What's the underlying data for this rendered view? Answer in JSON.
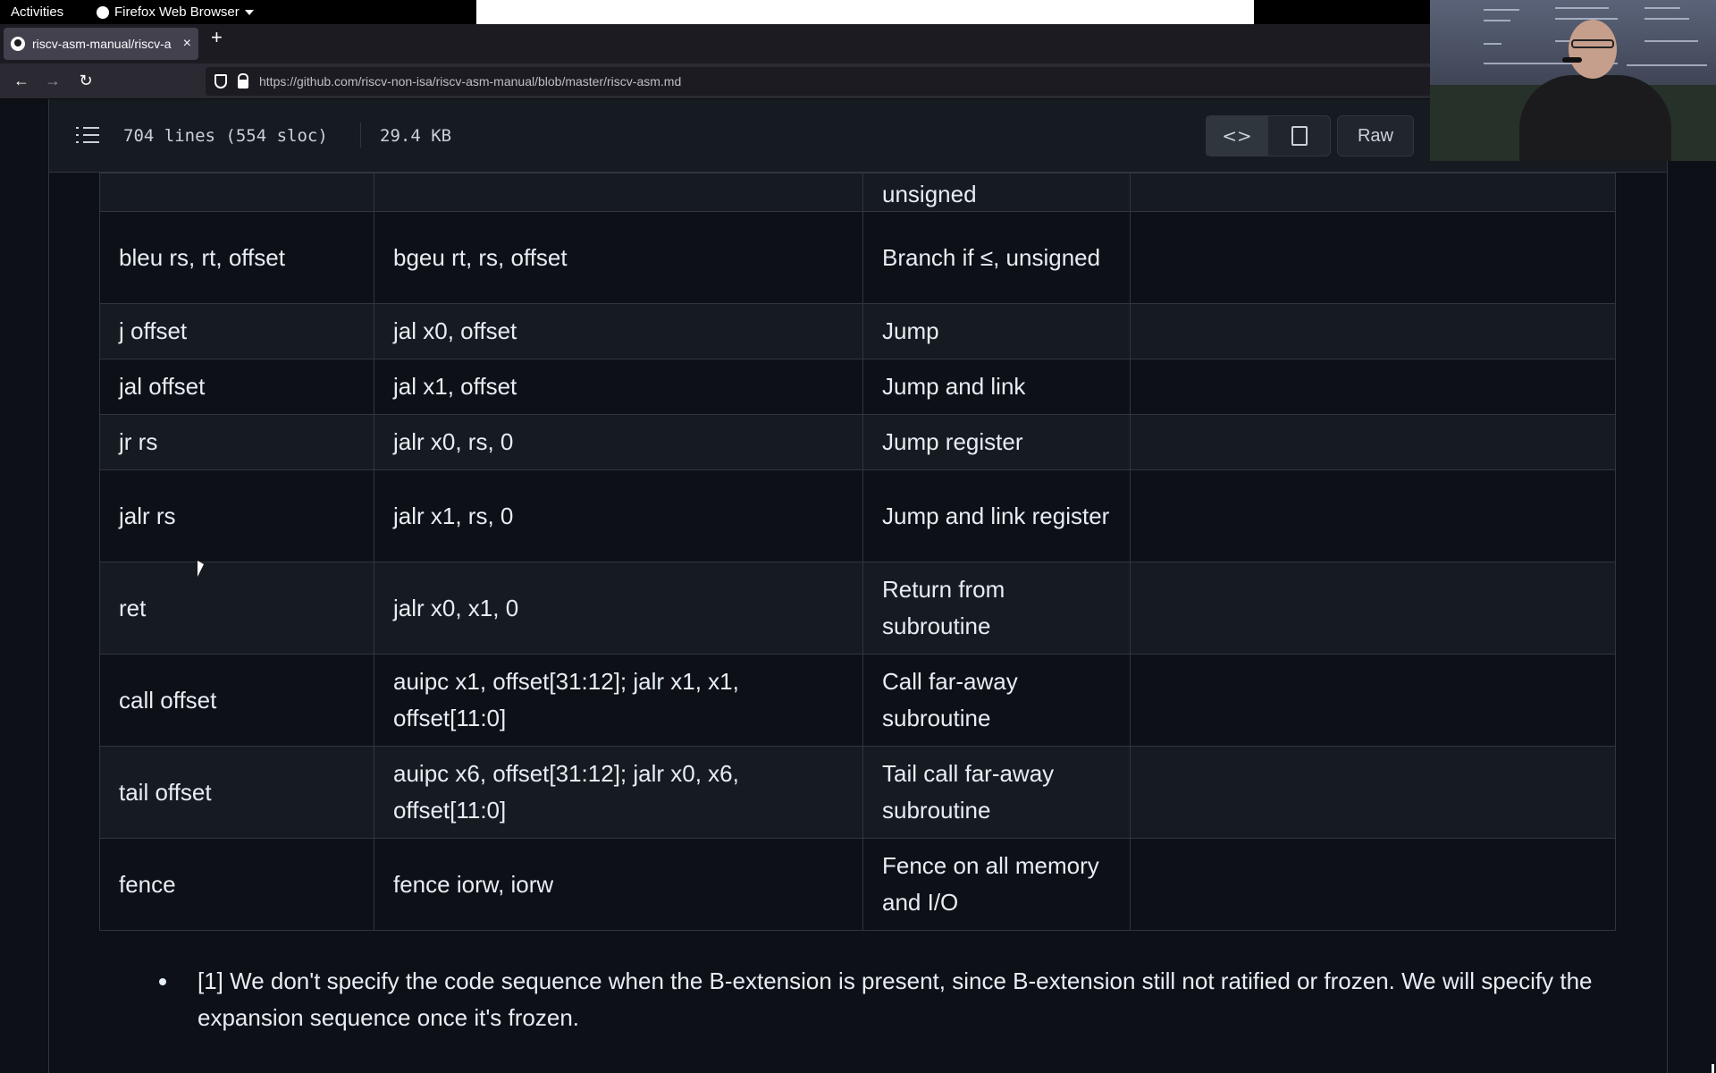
{
  "system": {
    "activities": "Activities",
    "app_name": "Firefox Web Browser"
  },
  "browser": {
    "tab_title": "riscv-asm-manual/riscv-a",
    "tab_close": "×",
    "new_tab": "+",
    "url": "https://github.com/riscv-non-isa/riscv-asm-manual/blob/master/riscv-asm.md",
    "nav": {
      "back": "←",
      "forward": "→",
      "reload": "↻"
    }
  },
  "file_header": {
    "lines": "704 lines (554 sloc)",
    "size": "29.4 KB",
    "code_icon": "<>",
    "raw_label": "Raw"
  },
  "table": {
    "rows": [
      {
        "c1": "",
        "c2": "",
        "c3": "unsigned",
        "c4": ""
      },
      {
        "c1": "bleu rs, rt, offset",
        "c2": "bgeu rt, rs, offset",
        "c3": "Branch if ≤, unsigned",
        "c4": ""
      },
      {
        "c1": "j offset",
        "c2": "jal x0, offset",
        "c3": "Jump",
        "c4": ""
      },
      {
        "c1": "jal offset",
        "c2": "jal x1, offset",
        "c3": "Jump and link",
        "c4": ""
      },
      {
        "c1": "jr rs",
        "c2": "jalr x0, rs, 0",
        "c3": "Jump register",
        "c4": ""
      },
      {
        "c1": "jalr rs",
        "c2": "jalr x1, rs, 0",
        "c3": "Jump and link register",
        "c4": ""
      },
      {
        "c1": "ret",
        "c2": "jalr x0, x1, 0",
        "c3": "Return from subroutine",
        "c4": ""
      },
      {
        "c1": "call offset",
        "c2": "auipc x1, offset[31:12]; jalr x1, x1, offset[11:0]",
        "c3": "Call far-away subroutine",
        "c4": ""
      },
      {
        "c1": "tail offset",
        "c2": "auipc x6, offset[31:12]; jalr x0, x6, offset[11:0]",
        "c3": "Tail call far-away subroutine",
        "c4": ""
      },
      {
        "c1": "fence",
        "c2": "fence iorw, iorw",
        "c3": "Fence on all memory and I/O",
        "c4": ""
      }
    ]
  },
  "footnote": "[1] We don't specify the code sequence when the B-extension is present, since B-extension still not ratified or frozen. We will specify the expansion sequence once it's frozen."
}
